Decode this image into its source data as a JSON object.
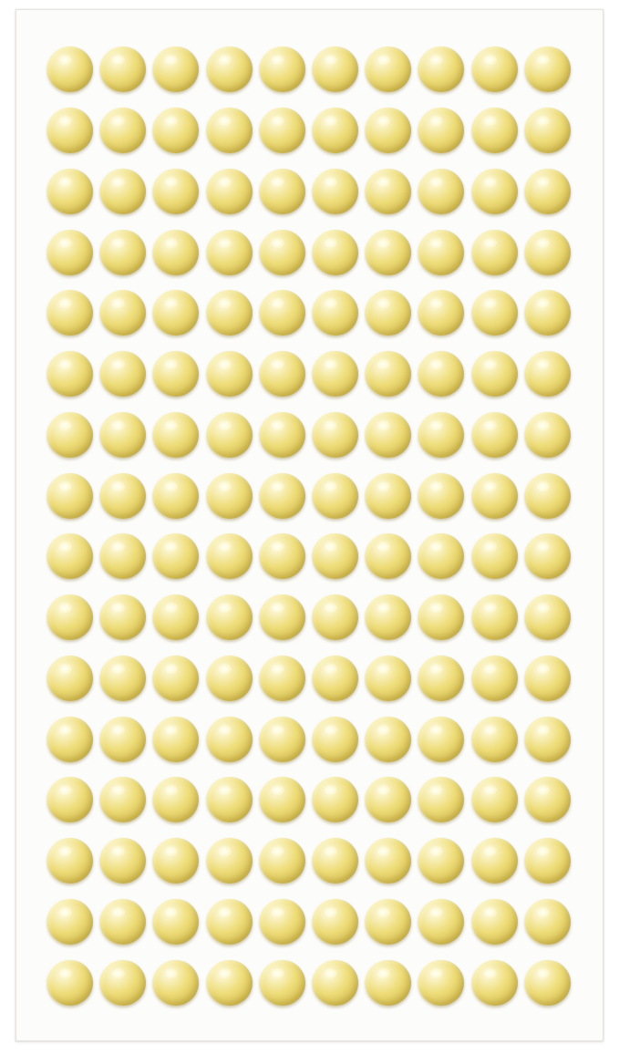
{
  "image": {
    "subject": "sheet-of-adhesive-half-pearls",
    "sheet": {
      "background_color": "#fcfcfa",
      "border_color": "#e6e4dd"
    },
    "pearls": {
      "rows": 16,
      "columns": 10,
      "total": 160,
      "base_color": "#eedd7a",
      "highlight_color": "#fffbe2",
      "shadow_color": "#c8ad3c"
    }
  }
}
